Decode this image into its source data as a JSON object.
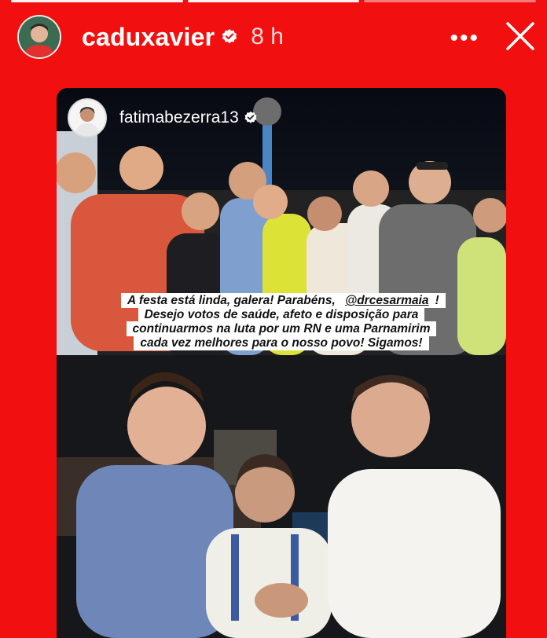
{
  "story": {
    "progress_segments": 3,
    "active_segment": 2
  },
  "header": {
    "username": "caduxavier",
    "time": "8 h",
    "menu_label": "•••"
  },
  "repost": {
    "username": "fatimabezerra13",
    "caption_before": "A festa está linda, galera! Parabéns, ",
    "mention": "@drcesarmaia",
    "caption_after": "! Desejo votos de saúde, afeto e disposição para continuarmos na luta por um RN e uma Parnamirim cada vez melhores para o nosso povo! Sigamos!"
  },
  "colors": {
    "background": "#f10f0f",
    "verified_badge": "#ffffff",
    "mention": "#2a5dd6"
  }
}
